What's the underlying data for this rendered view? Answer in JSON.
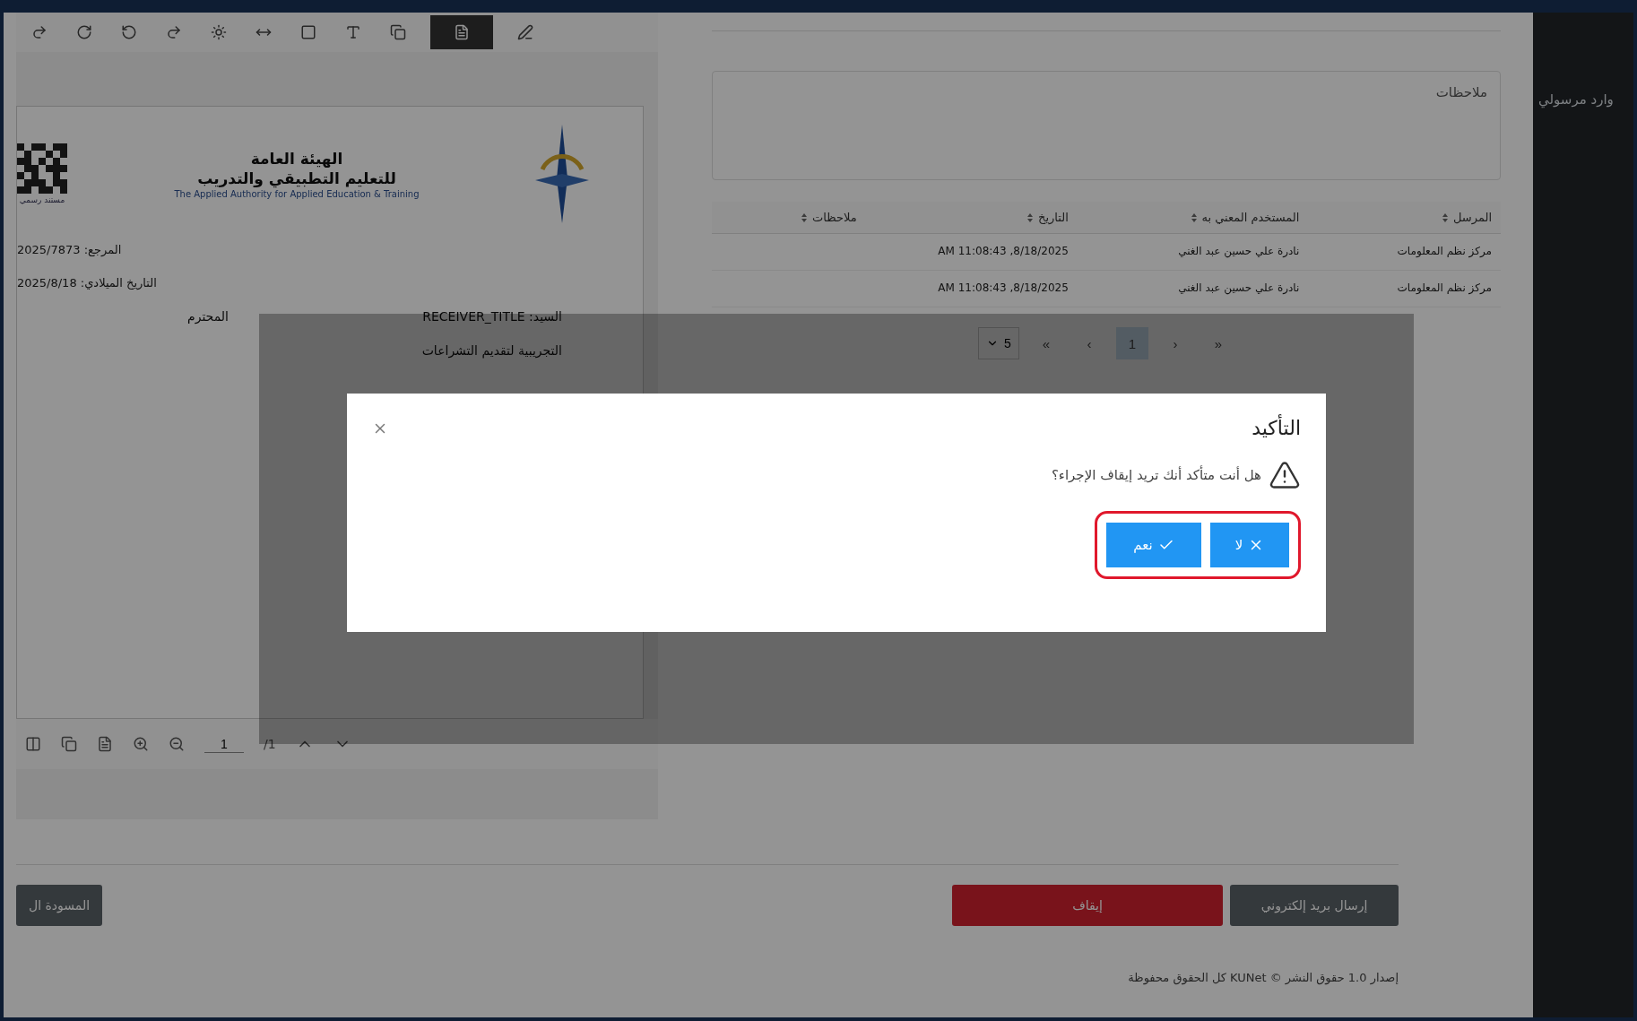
{
  "sidebar": {
    "title": "وارد مرسولي"
  },
  "viewer": {
    "toolbar": [
      {
        "selected": false
      },
      {
        "selected": false
      },
      {
        "selected": false
      },
      {
        "selected": false
      },
      {
        "selected": false
      },
      {
        "selected": false
      },
      {
        "selected": false
      },
      {
        "selected": false
      },
      {
        "selected": false
      },
      {
        "selected": true
      },
      {
        "selected": false
      }
    ],
    "document": {
      "qr_caption": "مستند رسمي",
      "org_name_line1": "الهيئة العامة",
      "org_name_line2": "للتعليم التطبيقي والتدريب",
      "org_name_en": "The Applied Authority for Applied Education & Training",
      "reference": "المرجع: 2025/7873",
      "date": "التاريخ الميلادي: 2025/8/18",
      "recipient_label": "السيد:",
      "recipient": "RECEIVER_TITLE",
      "honorific": "المحترم",
      "subject": "التجريبية لتقديم التشراعات"
    },
    "page_input": "1",
    "page_total": "/1"
  },
  "notes": {
    "placeholder": "ملاحظات"
  },
  "table": {
    "columns": [
      {
        "label": "المرسل"
      },
      {
        "label": "المستخدم المعني به"
      },
      {
        "label": "التاريخ"
      },
      {
        "label": "ملاحظات"
      }
    ],
    "rows": [
      [
        "مركز نظم المعلومات",
        "نادرة علي حسين عبد الغني",
        "8/18/2025, 11:08:43 AM",
        ""
      ],
      [
        "مركز نظم المعلومات",
        "نادرة علي حسين عبد الغني",
        "8/18/2025, 11:08:43 AM",
        ""
      ]
    ]
  },
  "pagination": {
    "items": [
      {
        "label": "«",
        "selected": false
      },
      {
        "label": "‹",
        "selected": false
      },
      {
        "label": "1",
        "selected": true
      },
      {
        "label": "›",
        "selected": false
      },
      {
        "label": "»",
        "selected": false
      }
    ],
    "page_size": "5"
  },
  "actions": [
    {
      "kind": "secondary",
      "label": "إرسال بريد إلكتروني"
    },
    {
      "kind": "danger",
      "label": "إيقاف"
    }
  ],
  "left_action": {
    "label": "المسودة ال"
  },
  "footer": "إصدار 1.0 حقوق النشر © KUNet كل الحقوق محفوظة",
  "dialog": {
    "title": "التأكيد",
    "message": "هل أنت متأكد أنك تريد إيقاف الإجراء؟",
    "buttons_highlighted": true,
    "buttons": [
      {
        "kind": "no",
        "label": "لا"
      },
      {
        "kind": "yes",
        "label": "نعم"
      }
    ]
  }
}
